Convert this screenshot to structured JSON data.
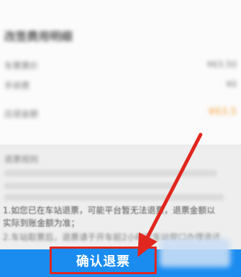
{
  "order_card": {
    "title": "改签费用明细",
    "rows": [
      {
        "label": "车票票价",
        "value": "¥63.50"
      },
      {
        "label": "手续费",
        "value": "¥0"
      },
      {
        "label": "应退金额",
        "value": "¥63.5",
        "highlight": true
      }
    ]
  },
  "notice": {
    "title": "退票规则",
    "lines": [
      {
        "text": "1.如您已在车站退票，可能平台暂无法退票，退票金额以",
        "faint": false
      },
      {
        "text": "实际到账金额为准；",
        "faint": false
      },
      {
        "text": "2.车站取票后，退票请于开车前2小时在车站窗口办理退还",
        "faint": true
      }
    ]
  },
  "footer": {
    "confirm_label": "确认退票"
  },
  "colors": {
    "primary_blue": "#1a8cf0",
    "annotation_red": "#e0261e",
    "amount_orange": "#f49a2e"
  }
}
